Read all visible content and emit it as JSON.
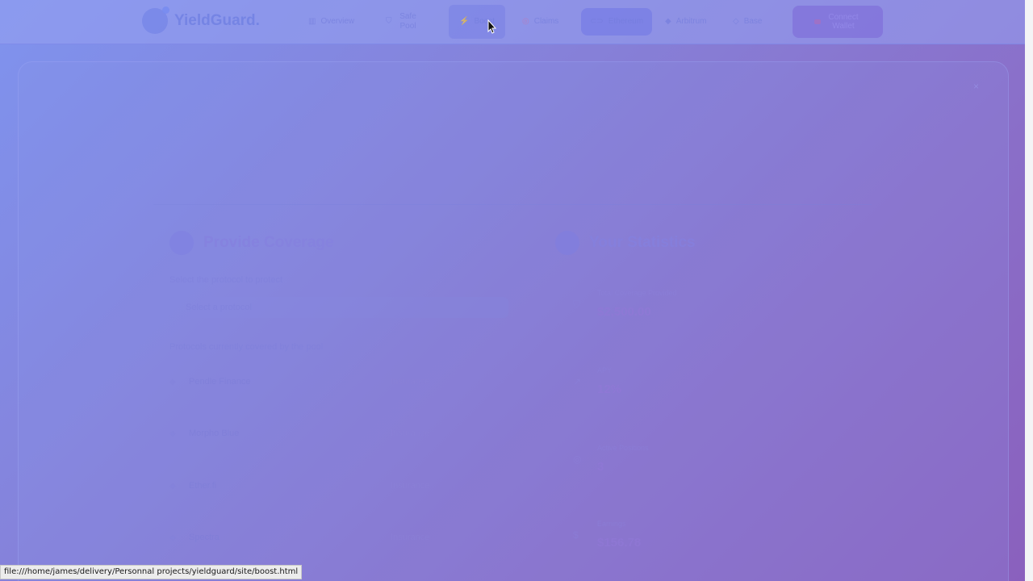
{
  "app": {
    "name": "YieldGuard."
  },
  "nav": {
    "items": [
      {
        "label": "Overview",
        "icon": "chart-icon"
      },
      {
        "label": "Safe Pool",
        "icon": "shield-icon"
      },
      {
        "label": "Boost",
        "icon": "bolt-icon"
      },
      {
        "label": "Claims",
        "icon": "target-icon"
      },
      {
        "label": "Ethereum",
        "icon": "link-icon"
      },
      {
        "label": "Arbitrum",
        "icon": "diamond-icon"
      },
      {
        "label": "Base",
        "icon": "circle-icon"
      }
    ],
    "connect_label": "Connect Wallet"
  },
  "main": {
    "coverage": {
      "title": "Provide Coverage",
      "select_label": "Select the protocol to protect",
      "select_value": "Select a protocol",
      "list_label": "Protocols currently covered by the pool",
      "protocols": [
        {
          "name": "Pendle Finance",
          "meta": "Insurance"
        },
        {
          "name": "Morpho Blue",
          "meta": "Insurance"
        },
        {
          "name": "Ether.fi",
          "meta": "Insurance"
        },
        {
          "name": "Spectra",
          "meta": "Insurance"
        }
      ]
    },
    "stats": {
      "title": "Your Statistics",
      "items": [
        {
          "label": "Total Coverage Provided",
          "value": "$2,500.00"
        },
        {
          "label": "APY",
          "value": "12%"
        },
        {
          "label": "Active Positions",
          "value": "3"
        },
        {
          "label": "Earnings",
          "value": "$156.78"
        }
      ]
    }
  },
  "statusbar": {
    "url": "file:///home/james/delivery/Personnal projects/yieldguard/site/boost.html"
  },
  "colors": {
    "accent": "#7a86e8",
    "background_start": "#7f93ee",
    "background_end": "#8a60bd"
  }
}
